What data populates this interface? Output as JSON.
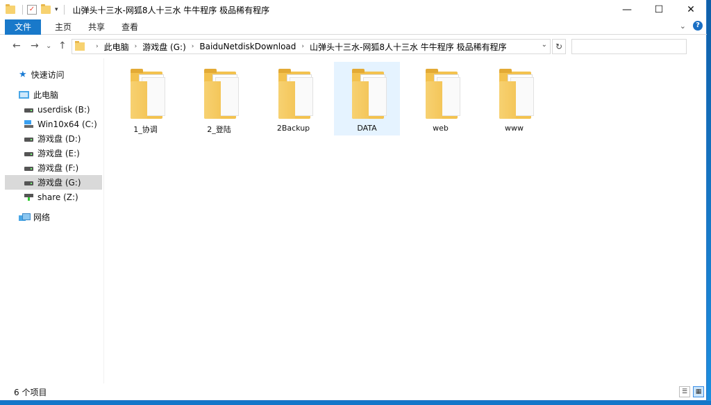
{
  "window": {
    "title": "山弹头十三水-网狐8人十三水 牛牛程序  极品稀有程序"
  },
  "caption": {
    "minimize": "—",
    "maximize": "☐",
    "close": "✕"
  },
  "ribbon": {
    "tabs": [
      "文件",
      "主页",
      "共享",
      "查看"
    ],
    "expand_glyph": "⌄",
    "help_glyph": "?"
  },
  "nav": {
    "back": "←",
    "forward": "→",
    "recent": "⌄",
    "up": "↑"
  },
  "address": {
    "crumbs": [
      "此电脑",
      "游戏盘 (G:)",
      "BaiduNetdiskDownload",
      "山弹头十三水-网狐8人十三水 牛牛程序  极品稀有程序"
    ],
    "dropdown": "⌄",
    "refresh": "↻",
    "search_placeholder": ""
  },
  "sidebar": {
    "quick_access": "快速访问",
    "this_pc": "此电脑",
    "drives": [
      {
        "label": "userdisk (B:)",
        "icon": "drive-icon"
      },
      {
        "label": "Win10x64 (C:)",
        "icon": "windows-drive-icon"
      },
      {
        "label": "游戏盘 (D:)",
        "icon": "drive-icon"
      },
      {
        "label": "游戏盘 (E:)",
        "icon": "drive-icon"
      },
      {
        "label": "游戏盘 (F:)",
        "icon": "drive-icon"
      },
      {
        "label": "游戏盘 (G:)",
        "icon": "drive-icon",
        "selected": true
      },
      {
        "label": "share (Z:)",
        "icon": "network-drive-icon"
      }
    ],
    "network": "网络"
  },
  "folders": [
    {
      "name": "1_协调"
    },
    {
      "name": "2_登陆"
    },
    {
      "name": "2Backup"
    },
    {
      "name": "DATA",
      "selected": true
    },
    {
      "name": "web"
    },
    {
      "name": "www"
    }
  ],
  "status": {
    "item_count": "6 个项目",
    "details_view": "☰",
    "icons_view": "▦"
  }
}
